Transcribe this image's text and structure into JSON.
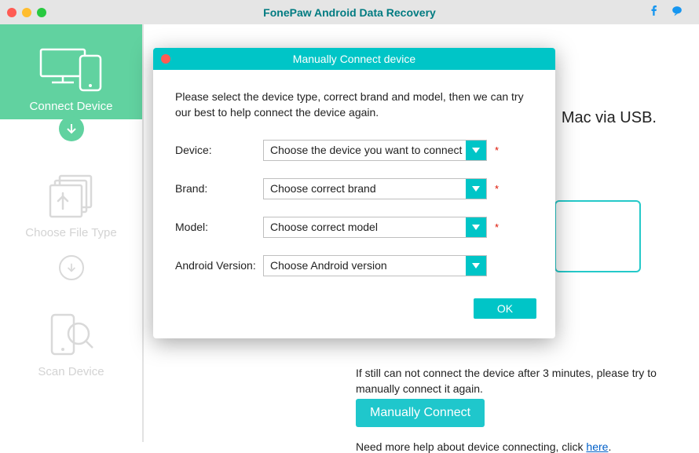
{
  "app": {
    "title": "FonePaw Android Data Recovery"
  },
  "sidebar": {
    "steps": [
      {
        "label": "Connect Device"
      },
      {
        "label": "Choose File Type"
      },
      {
        "label": "Scan Device"
      }
    ]
  },
  "main": {
    "bg_hint": "Mac via USB.",
    "still_text": "If still can not connect the device after 3 minutes, please try to manually connect it again.",
    "manually_btn": "Manually Connect",
    "help_prefix": "Need more help about device connecting, click ",
    "help_link": "here"
  },
  "modal": {
    "title": "Manually Connect device",
    "desc": "Please select the device type, correct brand and model, then we can try our best to help connect the device again.",
    "fields": {
      "device": {
        "label": "Device:",
        "placeholder": "Choose the device you want to connect",
        "required": true
      },
      "brand": {
        "label": "Brand:",
        "placeholder": "Choose correct brand",
        "required": true
      },
      "model": {
        "label": "Model:",
        "placeholder": "Choose correct model",
        "required": true
      },
      "android": {
        "label": "Android Version:",
        "placeholder": "Choose Android version",
        "required": false
      }
    },
    "ok": "OK"
  }
}
